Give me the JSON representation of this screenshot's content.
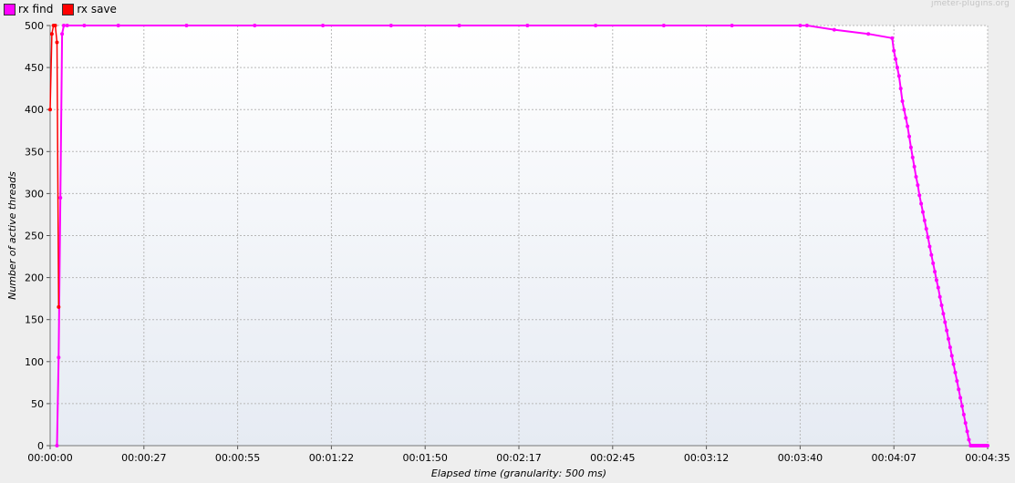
{
  "watermark": "jmeter-plugins.org",
  "legend": [
    {
      "label": "rx find",
      "color": "#ff00ff"
    },
    {
      "label": "rx save",
      "color": "#ff0000"
    }
  ],
  "chart_data": {
    "type": "line",
    "title": "",
    "xlabel": "Elapsed time (granularity: 500 ms)",
    "ylabel": "Number of active threads",
    "xlim": [
      0,
      275
    ],
    "ylim": [
      0,
      500
    ],
    "x_tick_labels": [
      "00:00:00",
      "00:00:27",
      "00:00:55",
      "00:01:22",
      "00:01:50",
      "00:02:17",
      "00:02:45",
      "00:03:12",
      "00:03:40",
      "00:04:07",
      "00:04:35"
    ],
    "y_ticks": [
      0,
      50,
      100,
      150,
      200,
      250,
      300,
      350,
      400,
      450,
      500
    ],
    "grid": true,
    "legend_position": "top-left",
    "series": [
      {
        "name": "rx find",
        "color": "#ff00ff",
        "x": [
          2.0,
          2.5,
          3.0,
          3.5,
          4.0,
          5,
          10,
          20,
          40,
          60,
          80,
          100,
          120,
          140,
          160,
          180,
          200,
          220,
          222,
          230,
          240,
          247,
          247.5,
          248,
          248.5,
          249,
          249.5,
          250,
          250.5,
          251,
          251.5,
          252,
          252.5,
          253,
          253.5,
          254,
          254.5,
          255,
          255.5,
          256,
          256.5,
          257,
          257.5,
          258,
          258.5,
          259,
          259.5,
          260,
          260.5,
          261,
          261.5,
          262,
          262.5,
          263,
          263.5,
          264,
          264.5,
          265,
          265.5,
          266,
          266.5,
          267,
          267.5,
          268,
          268.5,
          269,
          269.5,
          270,
          270.5,
          271,
          271.5,
          272,
          272.5,
          273,
          273.5,
          274,
          274.5,
          275
        ],
        "y": [
          0,
          105,
          295,
          490,
          500,
          500,
          500,
          500,
          500,
          500,
          500,
          500,
          500,
          500,
          500,
          500,
          500,
          500,
          500,
          495,
          490,
          485,
          470,
          460,
          450,
          440,
          425,
          410,
          400,
          390,
          380,
          368,
          355,
          343,
          332,
          320,
          310,
          298,
          288,
          278,
          268,
          258,
          248,
          237,
          227,
          217,
          207,
          197,
          188,
          177,
          167,
          157,
          147,
          137,
          127,
          117,
          107,
          97,
          87,
          77,
          67,
          57,
          47,
          37,
          27,
          17,
          7,
          0,
          0,
          0,
          0,
          0,
          0,
          0,
          0,
          0,
          0,
          0
        ]
      },
      {
        "name": "rx save",
        "color": "#ff0000",
        "x": [
          0.0,
          0.5,
          1.0,
          1.5,
          2.0,
          2.5
        ],
        "y": [
          400,
          490,
          500,
          500,
          480,
          165
        ]
      }
    ]
  }
}
